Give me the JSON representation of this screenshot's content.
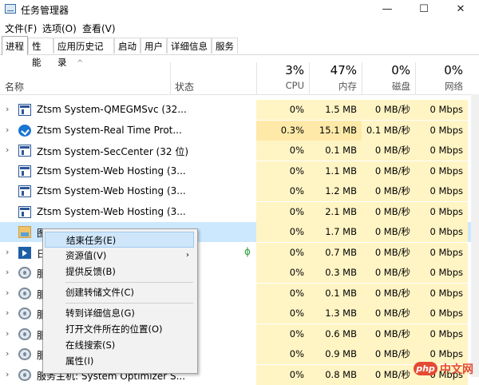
{
  "window": {
    "title": "任务管理器",
    "minimize": "—",
    "maximize": "☐",
    "close": "✕"
  },
  "menu": [
    "文件(F)",
    "选项(O)",
    "查看(V)"
  ],
  "tabs": [
    "进程",
    "性能",
    "应用历史记录",
    "启动",
    "用户",
    "详细信息",
    "服务"
  ],
  "active_tab": "进程",
  "columns": {
    "name": "名称",
    "status": "状态",
    "cpu": {
      "pct": "3%",
      "label": "CPU"
    },
    "memory": {
      "pct": "47%",
      "label": "内存"
    },
    "disk": {
      "pct": "0%",
      "label": "磁盘"
    },
    "network": {
      "pct": "0%",
      "label": "网络"
    }
  },
  "rows": [
    {
      "expand": "›",
      "icon": "window-icon",
      "name": "Ztsm System-QMEGMSvc (32...",
      "status": "",
      "cpu": "0%",
      "mem": "1.5 MB",
      "disk": "0 MB/秒",
      "net": "0 Mbps"
    },
    {
      "expand": "›",
      "icon": "shield-icon",
      "name": "Ztsm System-Real Time Prot...",
      "status": "",
      "cpu": "0.3%",
      "mem": "15.1 MB",
      "disk": "0.1 MB/秒",
      "net": "0 Mbps"
    },
    {
      "expand": "›",
      "icon": "window-icon",
      "name": "Ztsm System-SecCenter (32 位)",
      "status": "",
      "cpu": "0%",
      "mem": "0.1 MB",
      "disk": "0 MB/秒",
      "net": "0 Mbps"
    },
    {
      "expand": "",
      "icon": "window-icon",
      "name": "Ztsm System-Web Hosting (3...",
      "status": "",
      "cpu": "0%",
      "mem": "1.1 MB",
      "disk": "0 MB/秒",
      "net": "0 Mbps"
    },
    {
      "expand": "",
      "icon": "window-icon",
      "name": "Ztsm System-Web Hosting (3...",
      "status": "",
      "cpu": "0%",
      "mem": "1.2 MB",
      "disk": "0 MB/秒",
      "net": "0 Mbps"
    },
    {
      "expand": "",
      "icon": "window-icon",
      "name": "Ztsm System-Web Hosting (3...",
      "status": "",
      "cpu": "0%",
      "mem": "2.1 MB",
      "disk": "0 MB/秒",
      "net": "0 Mbps"
    },
    {
      "expand": "",
      "icon": "image-app-icon",
      "name": "图",
      "status": "",
      "cpu": "0%",
      "mem": "1.7 MB",
      "disk": "0 MB/秒",
      "net": "0 Mbps"
    },
    {
      "expand": "›",
      "icon": "media-app-icon",
      "name": "日",
      "status": "ϕ",
      "cpu": "0%",
      "mem": "0.7 MB",
      "disk": "0 MB/秒",
      "net": "0 Mbps"
    },
    {
      "expand": "›",
      "icon": "gear-icon",
      "name": "服",
      "status": "",
      "cpu": "0%",
      "mem": "0.3 MB",
      "disk": "0 MB/秒",
      "net": "0 Mbps"
    },
    {
      "expand": "›",
      "icon": "gear-icon",
      "name": "服",
      "status": "",
      "cpu": "0%",
      "mem": "0.1 MB",
      "disk": "0 MB/秒",
      "net": "0 Mbps"
    },
    {
      "expand": "›",
      "icon": "gear-icon",
      "name": "服",
      "status": "",
      "cpu": "0%",
      "mem": "1.3 MB",
      "disk": "0 MB/秒",
      "net": "0 Mbps"
    },
    {
      "expand": "›",
      "icon": "gear-icon",
      "name": "服",
      "status": "",
      "cpu": "0%",
      "mem": "0.6 MB",
      "disk": "0 MB/秒",
      "net": "0 Mbps"
    },
    {
      "expand": "›",
      "icon": "gear-icon",
      "name": "服",
      "status": "",
      "cpu": "0%",
      "mem": "0.9 MB",
      "disk": "0 MB/秒",
      "net": "0 Mbps"
    },
    {
      "expand": "›",
      "icon": "gear-icon",
      "name": "服务主机: System Optimizer S...",
      "status": "",
      "cpu": "0%",
      "mem": "0.8 MB",
      "disk": "0 MB/秒",
      "net": "0 Mbps"
    }
  ],
  "context_menu": {
    "end_task": "结束任务(E)",
    "resource_values": "资源值(V)",
    "submenu_arrow": "›",
    "feedback": "提供反馈(B)",
    "dump": "创建转储文件(C)",
    "goto_details": "转到详细信息(G)",
    "open_location": "打开文件所在的位置(O)",
    "search_online": "在线搜索(S)",
    "properties": "属性(I)"
  },
  "watermark": {
    "badge": "php",
    "text": "中文网"
  },
  "colors": {
    "selected_row": "#cce8ff",
    "heat_light": "#fff4c4",
    "heat_mid": "#ffe9a8",
    "menu_highlight": "#cfe6fa"
  }
}
